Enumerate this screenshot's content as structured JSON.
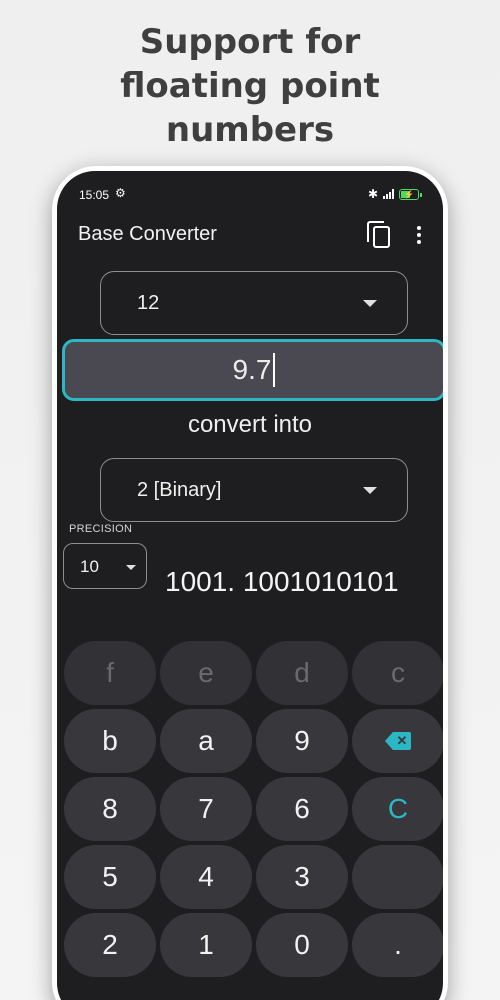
{
  "promo": {
    "line1": "Support for",
    "line2": "floating point",
    "line3": "numbers"
  },
  "status_bar": {
    "time": "15:05",
    "icons": [
      "settings-gear-icon",
      "bluetooth-icon",
      "signal-icon",
      "battery-charging-icon"
    ]
  },
  "app_bar": {
    "title": "Base Converter",
    "actions": [
      "copy-icon",
      "more-vert-icon"
    ]
  },
  "from_base": {
    "selected": "12"
  },
  "input": {
    "value": "9.7"
  },
  "convert_label": "convert into",
  "to_base": {
    "selected": "2 [Binary]"
  },
  "precision": {
    "label": "PRECISION",
    "selected": "10"
  },
  "result": {
    "value": "1001. 1001010101"
  },
  "keypad": {
    "row1": [
      "f",
      "e",
      "d",
      "c"
    ],
    "row2": [
      "b",
      "a",
      "9",
      "backspace"
    ],
    "row3": [
      "8",
      "7",
      "6",
      "C"
    ],
    "row4": [
      "5",
      "4",
      "3",
      ""
    ],
    "row5": [
      "2",
      "1",
      "0",
      "."
    ]
  },
  "colors": {
    "accent": "#2bb7c4",
    "background": "#1e1e20",
    "key": "#38383c",
    "input_fill": "#4a4850"
  }
}
